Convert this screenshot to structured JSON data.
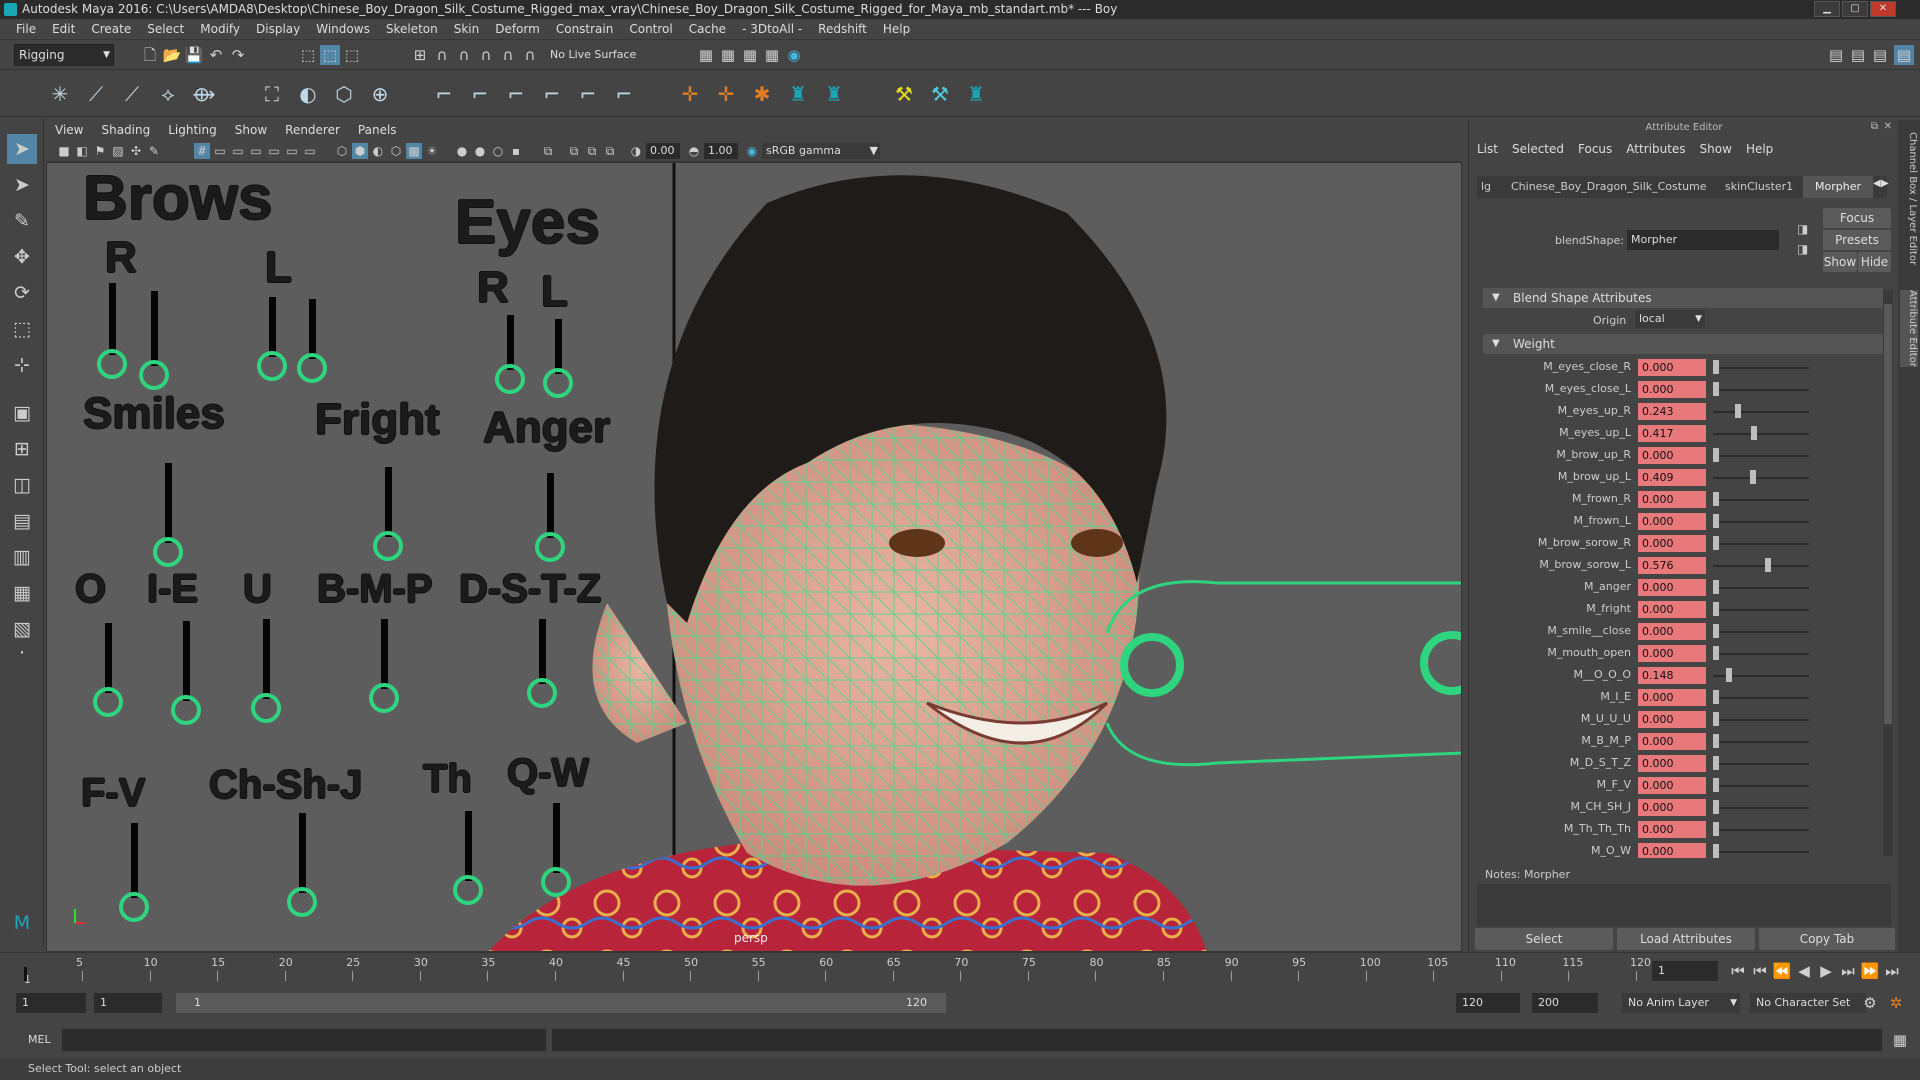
{
  "window": {
    "title": "Autodesk Maya 2016: C:\\Users\\AMDA8\\Desktop\\Chinese_Boy_Dragon_Silk_Costume_Rigged_max_vray\\Chinese_Boy_Dragon_Silk_Costume_Rigged_for_Maya_mb_standart.mb*  ---  Boy",
    "minimize": "▁",
    "maximize": "▢",
    "close": "✕"
  },
  "menus": [
    "File",
    "Edit",
    "Create",
    "Select",
    "Modify",
    "Display",
    "Windows",
    "Skeleton",
    "Skin",
    "Deform",
    "Constrain",
    "Control",
    "Cache",
    "- 3DtoAll -",
    "Redshift",
    "Help"
  ],
  "statusline": {
    "mode": "Rigging",
    "live_surface": "No Live Surface"
  },
  "viewport": {
    "menus": [
      "View",
      "Shading",
      "Lighting",
      "Show",
      "Renderer",
      "Panels"
    ],
    "exposure": "0.00",
    "gamma": "1.00",
    "color_space": "sRGB gamma",
    "camera": "persp",
    "labels": {
      "brows": "Brows",
      "brows_r": "R",
      "brows_l": "L",
      "eyes": "Eyes",
      "eyes_r": "R",
      "eyes_l": "L",
      "smiles": "Smiles",
      "fright": "Fright",
      "anger": "Anger",
      "o": "O",
      "i_e": "I-E",
      "u": "U",
      "b_m_p": "B-M-P",
      "d_s_t_z": "D-S-T-Z",
      "f_v": "F-V",
      "ch_sh_j": "Ch-Sh-J",
      "th": "Th",
      "q_w": "Q-W"
    }
  },
  "attribute_editor": {
    "title": "Attribute Editor",
    "menus": [
      "List",
      "Selected",
      "Focus",
      "Attributes",
      "Show",
      "Help"
    ],
    "tabs": [
      "lg",
      "Chinese_Boy_Dragon_Silk_Costume",
      "skinCluster1",
      "Morpher"
    ],
    "blendshape_label": "blendShape:",
    "blendshape_value": "Morpher",
    "focus": "Focus",
    "presets": "Presets",
    "show": "Show",
    "hide": "Hide",
    "section_bs": "Blend Shape Attributes",
    "origin_label": "Origin",
    "origin_value": "local",
    "section_weight": "Weight",
    "weights": [
      {
        "name": "M_eyes_close_R",
        "value": "0.000",
        "v": 0.0
      },
      {
        "name": "M_eyes_close_L",
        "value": "0.000",
        "v": 0.0
      },
      {
        "name": "M_eyes_up_R",
        "value": "0.243",
        "v": 0.243
      },
      {
        "name": "M_eyes_up_L",
        "value": "0.417",
        "v": 0.417
      },
      {
        "name": "M_brow_up_R",
        "value": "0.000",
        "v": 0.0
      },
      {
        "name": "M_brow_up_L",
        "value": "0.409",
        "v": 0.409
      },
      {
        "name": "M_frown_R",
        "value": "0.000",
        "v": 0.0
      },
      {
        "name": "M_frown_L",
        "value": "0.000",
        "v": 0.0
      },
      {
        "name": "M_brow_sorow_R",
        "value": "0.000",
        "v": 0.0
      },
      {
        "name": "M_brow_sorow_L",
        "value": "0.576",
        "v": 0.576
      },
      {
        "name": "M_anger",
        "value": "0.000",
        "v": 0.0
      },
      {
        "name": "M_fright",
        "value": "0.000",
        "v": 0.0
      },
      {
        "name": "M_smile__close",
        "value": "0.000",
        "v": 0.0
      },
      {
        "name": "M_mouth_open",
        "value": "0.000",
        "v": 0.0
      },
      {
        "name": "M__O_O_O",
        "value": "0.148",
        "v": 0.148
      },
      {
        "name": "M_I_E",
        "value": "0.000",
        "v": 0.0
      },
      {
        "name": "M_U_U_U",
        "value": "0.000",
        "v": 0.0
      },
      {
        "name": "M_B_M_P",
        "value": "0.000",
        "v": 0.0
      },
      {
        "name": "M_D_S_T_Z",
        "value": "0.000",
        "v": 0.0
      },
      {
        "name": "M_F_V",
        "value": "0.000",
        "v": 0.0
      },
      {
        "name": "M_CH_SH_J",
        "value": "0.000",
        "v": 0.0
      },
      {
        "name": "M_Th_Th_Th",
        "value": "0.000",
        "v": 0.0
      },
      {
        "name": "M_O_W",
        "value": "0.000",
        "v": 0.0
      }
    ],
    "notes_label": "Notes:  Morpher",
    "select": "Select",
    "load_attributes": "Load Attributes",
    "copy_tab": "Copy Tab",
    "side_channel": "Channel Box / Layer Editor",
    "side_attr": "Attribute Editor"
  },
  "timeline": {
    "ticks": [
      "5",
      "10",
      "15",
      "20",
      "25",
      "30",
      "35",
      "40",
      "45",
      "50",
      "55",
      "60",
      "65",
      "70",
      "75",
      "80",
      "85",
      "90",
      "95",
      "100",
      "105",
      "110",
      "115",
      "120"
    ],
    "first": "1",
    "current_frame": "1",
    "range_start": "1",
    "range_start2": "1",
    "range_inner_start": "1",
    "range_inner_end": "120",
    "range_end": "120",
    "range_end2": "200",
    "anim_layer": "No Anim Layer",
    "character_set": "No Character Set"
  },
  "cmdline": {
    "label": "MEL"
  },
  "helpline": {
    "text": "Select Tool: select an object"
  }
}
